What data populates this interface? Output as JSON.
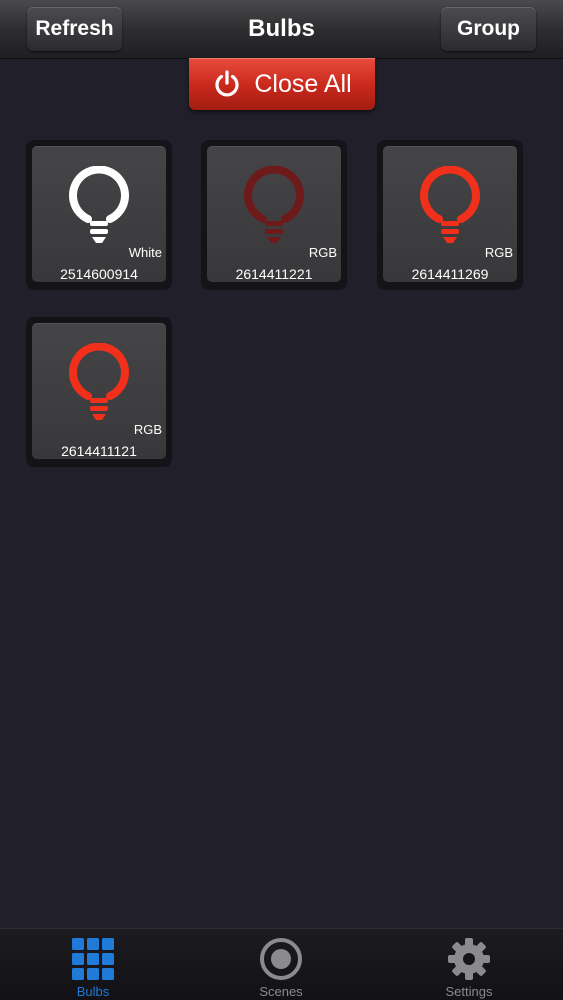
{
  "header": {
    "title": "Bulbs",
    "refresh_label": "Refresh",
    "group_label": "Group"
  },
  "close_all": {
    "label": "Close All",
    "color": "#d0301f"
  },
  "bulbs": [
    {
      "id": "2514600914",
      "type": "White",
      "color": "#ffffff",
      "icon": "lightbulb-icon"
    },
    {
      "id": "2614411221",
      "type": "RGB",
      "color": "#6e1a1a",
      "icon": "lightbulb-icon"
    },
    {
      "id": "2614411269",
      "type": "RGB",
      "color": "#f0301a",
      "icon": "lightbulb-icon"
    },
    {
      "id": "2614411121",
      "type": "RGB",
      "color": "#f0301a",
      "icon": "lightbulb-icon"
    }
  ],
  "tabs": [
    {
      "label": "Bulbs",
      "icon": "grid-icon",
      "active": true,
      "color": "#1f7ad8"
    },
    {
      "label": "Scenes",
      "icon": "eye-icon",
      "active": false,
      "color": "#8a8a8f"
    },
    {
      "label": "Settings",
      "icon": "gear-icon",
      "active": false,
      "color": "#8a8a8f"
    }
  ]
}
